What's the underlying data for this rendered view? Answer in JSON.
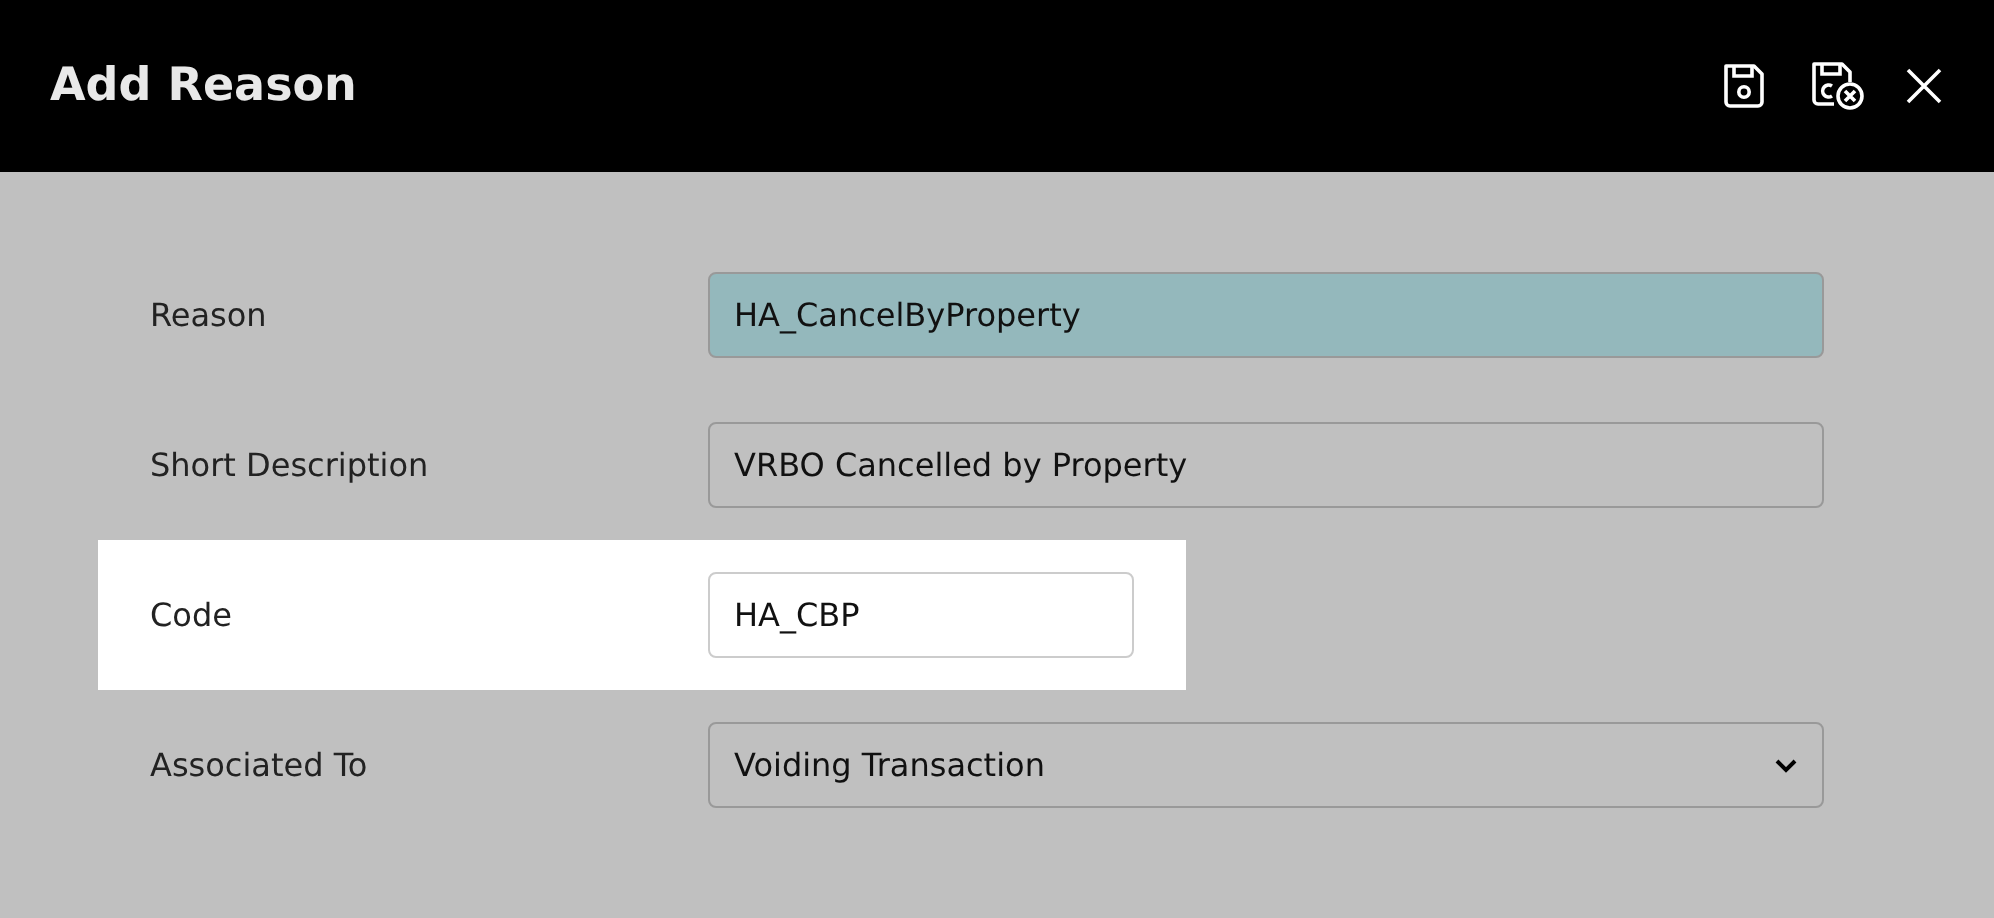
{
  "window": {
    "title": "Add Reason"
  },
  "toolbar": [
    {
      "kind": "save"
    },
    {
      "kind": "save-close"
    },
    {
      "kind": "close"
    }
  ],
  "fields": [
    {
      "label": "Reason",
      "kind": "text",
      "value": "HA_CancelByProperty",
      "focused": true,
      "highlighted": false
    },
    {
      "label": "Short Description",
      "kind": "text",
      "value": "VRBO Cancelled by Property",
      "focused": false,
      "highlighted": false
    },
    {
      "label": "Code",
      "kind": "short-text",
      "value": "HA_CBP",
      "focused": false,
      "highlighted": true
    },
    {
      "label": "Associated To",
      "kind": "select",
      "value": "Voiding Transaction",
      "focused": false,
      "highlighted": false
    }
  ]
}
